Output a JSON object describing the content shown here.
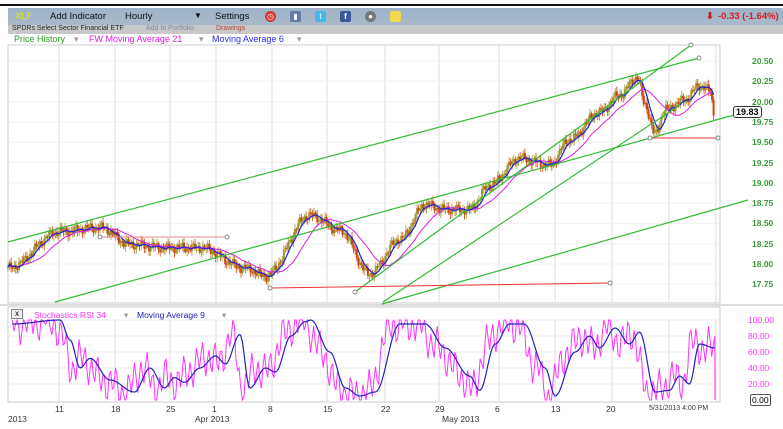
{
  "toolbar": {
    "symbol": "XLF",
    "add_indicator": "Add Indicator",
    "interval": "Hourly",
    "settings": "Settings",
    "change": "-0.33 (-1.64%)",
    "icons": [
      "alarm-clock-icon",
      "book-icon",
      "twitter-icon",
      "facebook-icon",
      "camera-icon",
      "note-icon"
    ]
  },
  "subheader": {
    "name": "SPDRs Select Sector Financial ETF",
    "add_portfolio": "Add to Portfolio",
    "drawings": "Drawings"
  },
  "legend": {
    "price": "Price History",
    "ma21": "FW Moving Average 21",
    "ma6": "Moving Average 6"
  },
  "colors": {
    "up": "#9a9a2e",
    "down": "#c9480c",
    "ma6": "#2020e0",
    "ma21": "#e020e0",
    "trend": "#33bb33",
    "red": "#ee3333",
    "stoch": "#ff33ff",
    "stoch_ma": "#2222bb"
  },
  "price_axis": [
    "20.50",
    "20.25",
    "20.00",
    "19.75",
    "19.50",
    "19.25",
    "19.00",
    "18.75",
    "18.50",
    "18.25",
    "18.00",
    "17.75"
  ],
  "last_price": "19.83",
  "chart_data": {
    "type": "candlestick",
    "x_unit": "trading days from Mar 11 2013",
    "price_path": [
      [
        -4.6,
        17.95
      ],
      [
        0.1,
        18.4
      ],
      [
        3.7,
        18.45
      ],
      [
        6.4,
        18.24
      ],
      [
        9.5,
        18.2
      ],
      [
        12.7,
        18.2
      ],
      [
        16.8,
        17.95
      ],
      [
        18.6,
        17.85
      ],
      [
        22.6,
        18.6
      ],
      [
        25.3,
        18.42
      ],
      [
        28.0,
        17.88
      ],
      [
        30.7,
        18.3
      ],
      [
        33.0,
        18.73
      ],
      [
        34.8,
        18.67
      ],
      [
        37.0,
        18.67
      ],
      [
        38.8,
        18.97
      ],
      [
        41.5,
        19.3
      ],
      [
        44.2,
        19.22
      ],
      [
        46.0,
        19.53
      ],
      [
        48.7,
        19.87
      ],
      [
        50.5,
        20.08
      ],
      [
        52.1,
        20.3
      ],
      [
        52.8,
        19.96
      ],
      [
        53.7,
        19.6
      ],
      [
        54.6,
        19.9
      ],
      [
        56.4,
        20.02
      ],
      [
        57.7,
        20.2
      ],
      [
        58.6,
        20.14
      ],
      [
        59.1,
        19.83
      ]
    ],
    "ylim": [
      17.65,
      20.7
    ]
  },
  "stoch": {
    "title": "Stochastics RSI 34",
    "ma_label": "Moving Average 9",
    "axis": [
      "100.00",
      "80.00",
      "60.00",
      "40.00",
      "20.00"
    ],
    "last": "0.00",
    "ma_path": [
      [
        -4.2,
        95
      ],
      [
        0.1,
        100
      ],
      [
        1.0,
        75
      ],
      [
        1.9,
        40
      ],
      [
        2.8,
        52
      ],
      [
        4.6,
        25
      ],
      [
        6.8,
        10
      ],
      [
        8.2,
        40
      ],
      [
        9.5,
        15
      ],
      [
        10.4,
        28
      ],
      [
        11.3,
        22
      ],
      [
        12.7,
        40
      ],
      [
        14.1,
        55
      ],
      [
        15.0,
        45
      ],
      [
        16.3,
        82
      ],
      [
        17.2,
        15
      ],
      [
        18.6,
        40
      ],
      [
        19.5,
        35
      ],
      [
        20.9,
        80
      ],
      [
        22.2,
        98
      ],
      [
        22.7,
        100
      ],
      [
        24.4,
        60
      ],
      [
        25.8,
        15
      ],
      [
        27.1,
        5
      ],
      [
        28.5,
        10
      ],
      [
        30.7,
        95
      ],
      [
        33.0,
        95
      ],
      [
        34.8,
        65
      ],
      [
        37.0,
        30
      ],
      [
        37.9,
        12
      ],
      [
        39.3,
        70
      ],
      [
        40.6,
        95
      ],
      [
        41.9,
        95
      ],
      [
        43.8,
        40
      ],
      [
        44.7,
        5
      ],
      [
        46.5,
        60
      ],
      [
        47.8,
        80
      ],
      [
        48.7,
        65
      ],
      [
        50.1,
        90
      ],
      [
        51.4,
        70
      ],
      [
        52.3,
        85
      ],
      [
        53.7,
        10
      ],
      [
        55.0,
        12
      ],
      [
        55.9,
        30
      ],
      [
        56.8,
        20
      ],
      [
        57.7,
        70
      ],
      [
        59.1,
        65
      ]
    ]
  },
  "x_axis": {
    "days": [
      "11",
      "18",
      "25",
      "1",
      "8",
      "15",
      "22",
      "29",
      "6",
      "13",
      "20"
    ],
    "months": [
      "2013",
      "Apr 2013",
      "May 2013"
    ],
    "timestamp": "5/31/2013 4:00 PM"
  }
}
